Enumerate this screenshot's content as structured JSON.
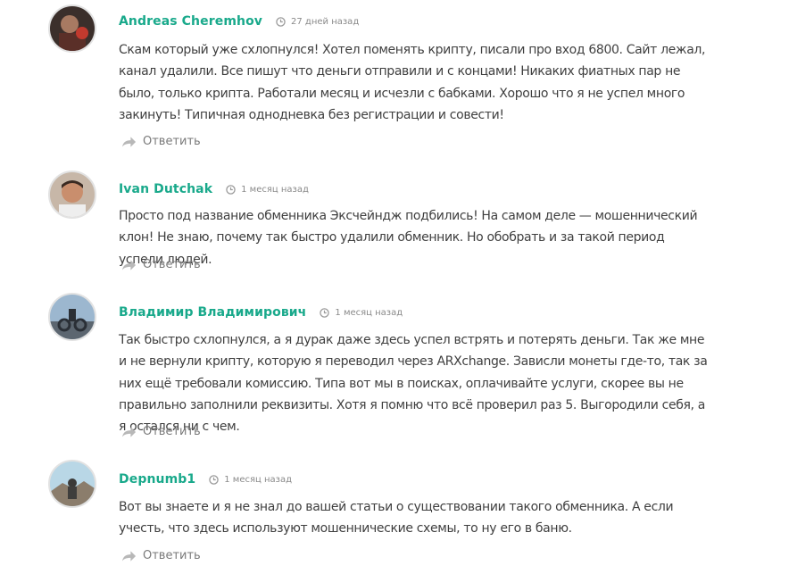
{
  "comments": [
    {
      "author": "Andreas Cheremhov",
      "time": "27 дней назад",
      "text": "Скам который уже схлопнулся! Хотел поменять крипту, писали про вход 6800. Сайт лежал, канал удалили. Все пишут что деньги отправили и с концами! Никаких фиатных пар не было, только крипта. Работали месяц и исчезли с бабками. Хорошо что я не успел много закинуть! Типичная однодневка без регистрации и совести!",
      "reply_label": "Ответить"
    },
    {
      "author": "Ivan Dutchak",
      "time": "1 месяц назад",
      "text": "Просто под название обменника Эксчейндж подбились! На самом деле — мошеннический клон! Не знаю, почему так быстро удалили обменник. Но обобрать и за такой период успели людей.",
      "reply_label": "Ответить"
    },
    {
      "author": "Владимир Владимирович",
      "time": "1 месяц назад",
      "text": "Так быстро схлопнулся, а я дурак даже здесь успел встрять и потерять деньги. Так же мне и не вернули крипту, которую я переводил через ARXchange. Зависли монеты где-то, так за них ещё требовали комиссию. Типа вот мы в поисках, оплачивайте услуги, скорее вы не правильно заполнили реквизиты. Хотя я помню что всё проверил раз 5. Выгородили себя, а я остался ни с чем.",
      "reply_label": "Ответить"
    },
    {
      "author": "Depnumb1",
      "time": "1 месяц назад",
      "text": "Вот вы знаете и я не знал до вашей статьи о существовании такого обменника. А если учесть, что здесь используют мошеннические схемы, то ну его в баню.",
      "reply_label": "Ответить"
    }
  ],
  "colors": {
    "author": "#19a98b",
    "meta": "#8a8a8a",
    "text": "#3f3f3f",
    "reply": "#7a7a7a"
  },
  "icons": {
    "time": "clock-icon",
    "reply": "reply-arrow-icon"
  }
}
